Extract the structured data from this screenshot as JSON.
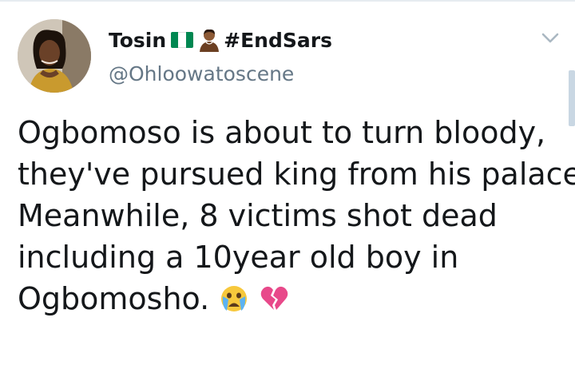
{
  "user": {
    "display_name": "Tosin",
    "hashtag": "#EndSars",
    "handle": "@Ohloowatoscene",
    "flag_colors": [
      "#008751",
      "#ffffff",
      "#008751"
    ]
  },
  "tweet": {
    "lines": [
      "Ogbomoso is about to turn bloody,",
      "they've pursued king from his palace.",
      "Meanwhile, 8 victims shot dead",
      "including a 10year old boy in",
      "Ogbomosho."
    ],
    "emojis": [
      "crying-face-icon",
      "broken-heart-icon"
    ]
  },
  "icons": {
    "menu": "chevron-down-icon"
  }
}
